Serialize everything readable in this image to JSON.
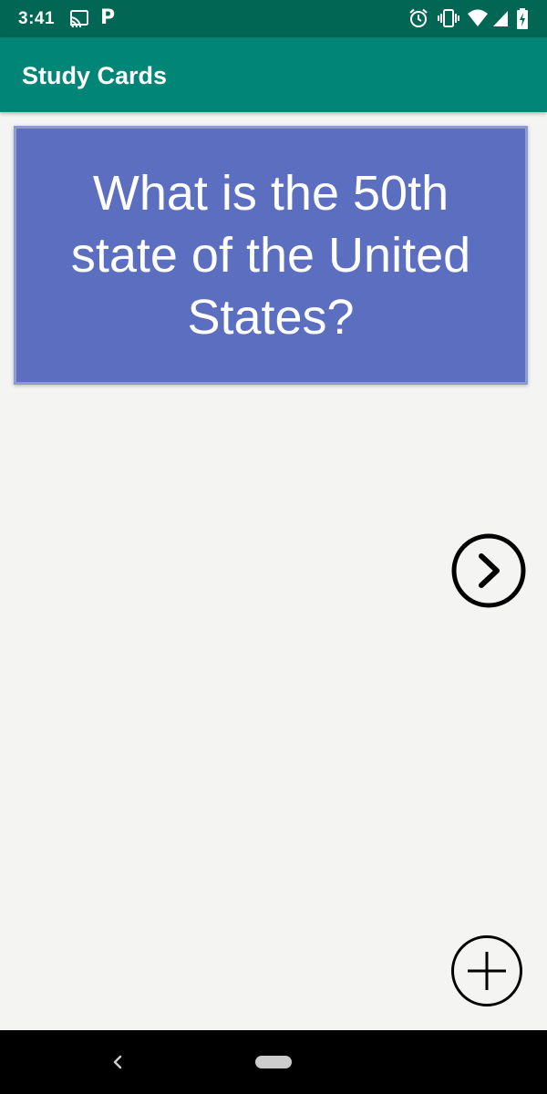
{
  "status_bar": {
    "time": "3:41",
    "notification_letter": "P",
    "left_icons": [
      "cast-icon",
      "parking-p-icon"
    ],
    "right_icons": [
      "alarm-icon",
      "vibrate-icon",
      "wifi-icon",
      "cell-signal-icon",
      "battery-charging-icon"
    ],
    "background_color": "#016654"
  },
  "app_bar": {
    "title": "Study Cards",
    "background_color": "#008577"
  },
  "flashcard": {
    "question": "What is the 50th state of the United States?",
    "background_color": "#5b6ec0"
  },
  "controls": {
    "next_icon": "chevron-right-circle-icon",
    "add_icon": "plus-circle-icon"
  },
  "nav_bar": {
    "icons": [
      "back-icon",
      "home-pill-icon"
    ]
  }
}
